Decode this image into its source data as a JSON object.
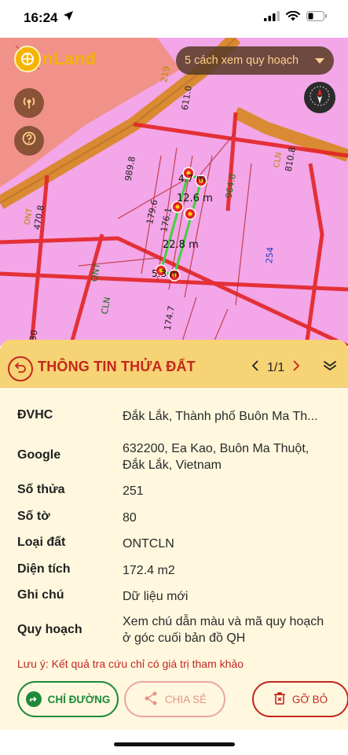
{
  "status_bar": {
    "time": "16:24"
  },
  "map": {
    "logo_text": "nLand",
    "view_selector_label": "5 cách xem quy hoạch",
    "zone_labels": [
      "989.8",
      "611.0",
      "964.0",
      "810.8",
      "470.8",
      "179.6",
      "176.1",
      "174.7",
      "254",
      "ONT",
      "CLN",
      "ONT",
      "CLN",
      "219",
      "30"
    ],
    "measurements": [
      "4.7 m",
      "12.6 m",
      "22.8 m",
      "5.3 m"
    ]
  },
  "panel": {
    "title": "THÔNG TIN THỬA ĐẤT",
    "pager": "1/1",
    "rows": [
      {
        "key": "ĐVHC",
        "value": "Đắk Lắk, Thành phố Buôn Ma Th..."
      },
      {
        "key": "Google",
        "value": "632200, Ea Kao, Buôn Ma Thuột, Đắk Lắk, Vietnam"
      },
      {
        "key": "Số thửa",
        "value": "251"
      },
      {
        "key": "Số tờ",
        "value": "80"
      },
      {
        "key": "Loại đất",
        "value": "ONTCLN"
      },
      {
        "key": "Diện tích",
        "value": "172.4 m2"
      },
      {
        "key": "Ghi chú",
        "value": "Dữ liệu mới"
      },
      {
        "key": "Quy hoạch",
        "value": "Xem chú dẫn màu và mã quy hoạch ở góc cuối bản đồ QH"
      }
    ],
    "note": "Lưu ý: Kết quả tra cứu chỉ có giá trị tham khảo",
    "actions": {
      "directions": "CHỈ ĐƯỜNG",
      "share": "CHIA SẺ",
      "remove": "GỠ BỎ"
    }
  },
  "colors": {
    "accent_red": "#c4271e",
    "header_yellow": "#f6d374",
    "panel_bg": "#fff8df",
    "map_pink": "#f3a6e8",
    "action_green": "#1e8a3a"
  }
}
